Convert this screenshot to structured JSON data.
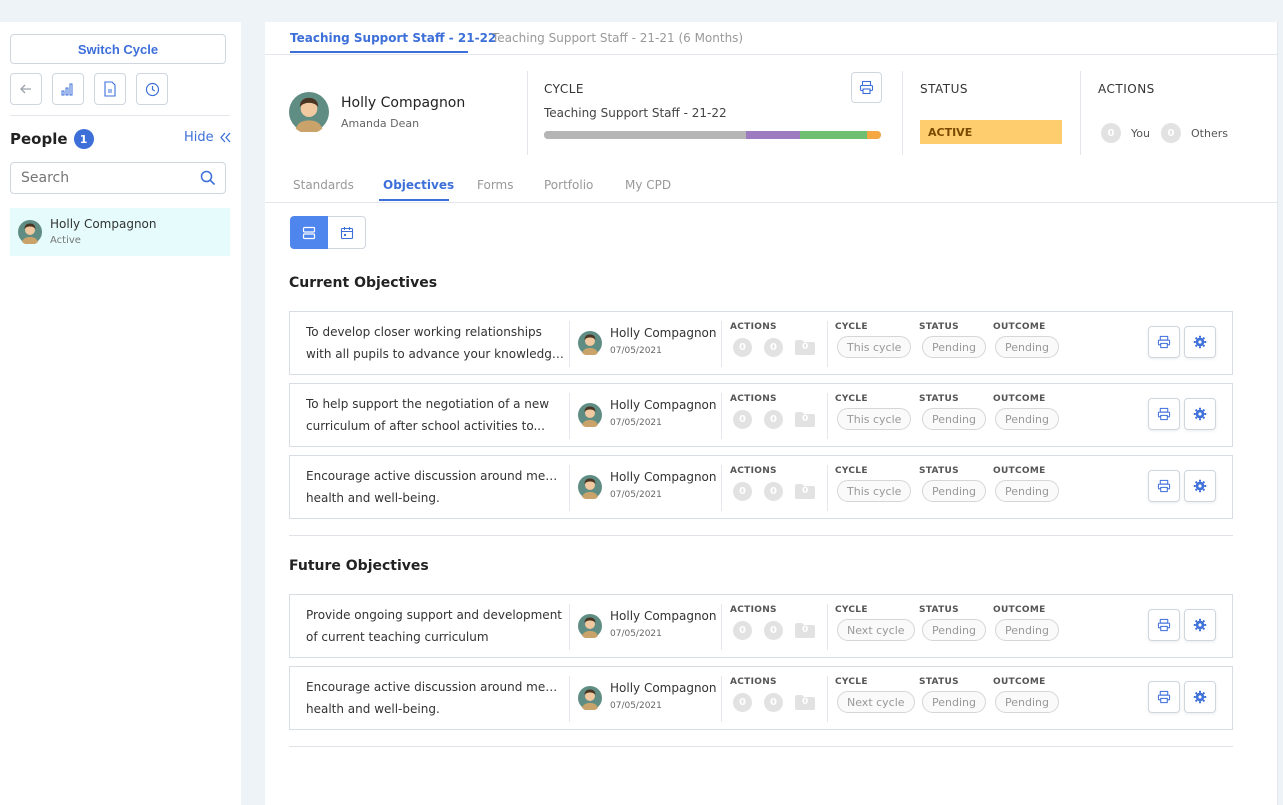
{
  "sidebar": {
    "switch_cycle_label": "Switch Cycle",
    "people_label": "People",
    "people_count": "1",
    "hide_label": "Hide",
    "search_placeholder": "Search",
    "people": [
      {
        "name": "Holly Compagnon",
        "status": "Active"
      }
    ]
  },
  "top_tabs": [
    {
      "label": "Teaching Support Staff - 21-22",
      "active": true
    },
    {
      "label": "Teaching Support Staff - 21-21 (6 Months)",
      "active": false
    }
  ],
  "profile": {
    "name": "Holly Compagnon",
    "manager": "Amanda Dean"
  },
  "cycle": {
    "label": "CYCLE",
    "value": "Teaching Support Staff - 21-22",
    "progress_segments": [
      {
        "fraction": 0.6,
        "color": "#b5b5b5"
      },
      {
        "fraction": 0.16,
        "color": "#9c7bc0"
      },
      {
        "fraction": 0.2,
        "color": "#6fbf73"
      },
      {
        "fraction": 0.04,
        "color": "#f5a742"
      }
    ]
  },
  "status": {
    "label": "STATUS",
    "value": "ACTIVE"
  },
  "actions": {
    "label": "ACTIONS",
    "you_count": "0",
    "you_label": "You",
    "others_count": "0",
    "others_label": "Others"
  },
  "sub_tabs": [
    {
      "label": "Standards",
      "active": false
    },
    {
      "label": "Objectives",
      "active": true
    },
    {
      "label": "Forms",
      "active": false
    },
    {
      "label": "Portfolio",
      "active": false
    },
    {
      "label": "My CPD",
      "active": false
    }
  ],
  "columns": {
    "actions": "ACTIONS",
    "cycle": "CYCLE",
    "status": "STATUS",
    "outcome": "OUTCOME"
  },
  "current_title": "Current Objectives",
  "future_title": "Future Objectives",
  "current_objectives": [
    {
      "line1": "To develop closer working relationships",
      "line2": "with all pupils to advance your knowledge...",
      "owner": "Holly Compagnon",
      "date": "07/05/2021",
      "c1": "0",
      "c2": "0",
      "c3": "0",
      "cycle": "This cycle",
      "status": "Pending",
      "outcome": "Pending"
    },
    {
      "line1": "To help support the negotiation of a new",
      "line2": "curriculum of after school activities to...",
      "owner": "Holly Compagnon",
      "date": "07/05/2021",
      "c1": "0",
      "c2": "0",
      "c3": "0",
      "cycle": "This cycle",
      "status": "Pending",
      "outcome": "Pending"
    },
    {
      "line1": "Encourage active discussion around mental",
      "line2": "health and well-being.",
      "owner": "Holly Compagnon",
      "date": "07/05/2021",
      "c1": "0",
      "c2": "0",
      "c3": "0",
      "cycle": "This cycle",
      "status": "Pending",
      "outcome": "Pending"
    }
  ],
  "future_objectives": [
    {
      "line1": "Provide ongoing support and development",
      "line2": "of current teaching curriculum",
      "owner": "Holly Compagnon",
      "date": "07/05/2021",
      "c1": "0",
      "c2": "0",
      "c3": "0",
      "cycle": "Next cycle",
      "status": "Pending",
      "outcome": "Pending"
    },
    {
      "line1": "Encourage active discussion around mental",
      "line2": "health and well-being.",
      "owner": "Holly Compagnon",
      "date": "07/05/2021",
      "c1": "0",
      "c2": "0",
      "c3": "0",
      "cycle": "Next cycle",
      "status": "Pending",
      "outcome": "Pending"
    }
  ],
  "colors": {
    "accent": "#3d6fd9",
    "status_active": "#fdcd6e"
  }
}
